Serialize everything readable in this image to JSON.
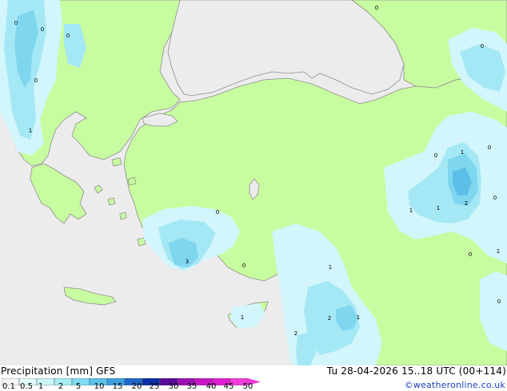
{
  "legend": {
    "title": "Precipitation [mm]  GFS",
    "scale_labels": [
      "0.1",
      "0.5",
      "1",
      "2",
      "5",
      "10",
      "15",
      "20",
      "25",
      "30",
      "35",
      "40",
      "45",
      "50"
    ],
    "scale_colors": [
      "#f5f5f5",
      "#e2fbfb",
      "#c9f5f7",
      "#a8ecf5",
      "#7fdcf0",
      "#5cc2ea",
      "#3c9fe0",
      "#2166c9",
      "#0d2fa6",
      "#5a0a9a",
      "#9b11b2",
      "#c718c4",
      "#e01fd0",
      "#f03cd8"
    ]
  },
  "model_run": "Tu 28-04-2026 15..18 UTC (00+114)",
  "copyright": "©weatheronline.co.uk",
  "map": {
    "colors": {
      "sea": "#ececec",
      "land": "#c8fca0",
      "border": "#8e8e8e",
      "precip_light": "#d2f6fb",
      "precip_mid": "#a5e8f5",
      "precip_strong": "#7fd6ef",
      "precip_core": "#5cbfe8"
    },
    "value_labels": [
      "0",
      "0",
      "0",
      "0",
      "0",
      "0",
      "1",
      "1",
      "1",
      "1",
      "2",
      "2",
      "0",
      "0",
      "1",
      "0",
      "1",
      "2",
      "1",
      "3",
      "0",
      "0",
      "1",
      "0",
      "0"
    ]
  }
}
